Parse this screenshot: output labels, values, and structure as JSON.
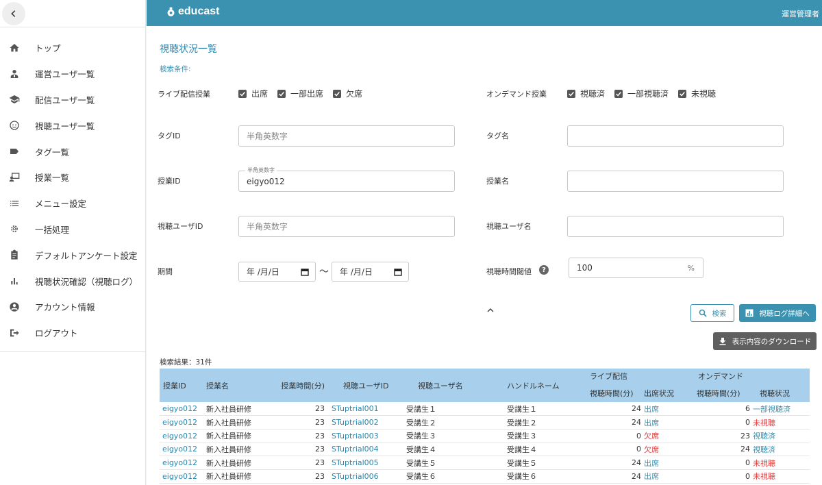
{
  "sidebar": {
    "items": [
      {
        "label": "トップ",
        "icon": "home-icon"
      },
      {
        "label": "運営ユーザ一覧",
        "icon": "admin-user-icon"
      },
      {
        "label": "配信ユーザ一覧",
        "icon": "graduation-cap-icon"
      },
      {
        "label": "視聴ユーザ一覧",
        "icon": "face-icon"
      },
      {
        "label": "タグ一覧",
        "icon": "tag-icon"
      },
      {
        "label": "授業一覧",
        "icon": "lecture-icon"
      },
      {
        "label": "メニュー設定",
        "icon": "list-icon"
      },
      {
        "label": "一括処理",
        "icon": "gear-icon"
      },
      {
        "label": "デフォルトアンケート設定",
        "icon": "clipboard-icon"
      },
      {
        "label": "視聴状況確認（視聴ログ）",
        "icon": "bar-chart-icon"
      },
      {
        "label": "アカウント情報",
        "icon": "account-icon"
      },
      {
        "label": "ログアウト",
        "icon": "logout-icon"
      }
    ]
  },
  "header": {
    "brand": "educast",
    "user": "運営管理者"
  },
  "page": {
    "title": "視聴状況一覧",
    "conditions_label": "検索条件:"
  },
  "filters": {
    "live_label": "ライブ配信授業",
    "live_options": [
      "出席",
      "一部出席",
      "欠席"
    ],
    "ondemand_label": "オンデマンド授業",
    "ondemand_options": [
      "視聴済",
      "一部視聴済",
      "未視聴"
    ],
    "tag_id_label": "タグID",
    "tag_id_placeholder": "半角英数字",
    "tag_name_label": "タグ名",
    "lecture_id_label": "授業ID",
    "lecture_id_floating": "半角英数字",
    "lecture_id_value": "eigyo012",
    "lecture_name_label": "授業名",
    "viewer_id_label": "視聴ユーザID",
    "viewer_id_placeholder": "半角英数字",
    "viewer_name_label": "視聴ユーザ名",
    "period_label": "期間",
    "date_placeholder": "年 /月/日",
    "tilde": "～",
    "threshold_label": "視聴時間閾値",
    "threshold_value": "100",
    "threshold_unit": "%"
  },
  "buttons": {
    "search": "検索",
    "log_detail": "視聴ログ詳細へ",
    "download": "表示内容のダウンロード"
  },
  "results": {
    "summary": "検索結果：31件"
  },
  "table": {
    "headers": {
      "lecture_id": "授業ID",
      "lecture_name": "授業名",
      "lecture_time": "授業時間(分)",
      "viewer_id": "視聴ユーザID",
      "viewer_name": "視聴ユーザ名",
      "handle": "ハンドルネーム",
      "live": "ライブ配信",
      "ondemand": "オンデマンド",
      "live_time": "視聴時間(分)",
      "live_status": "出席状況",
      "od_time": "視聴時間(分)",
      "od_status": "視聴状況"
    },
    "rows": [
      {
        "id": "eigyo012",
        "name": "新入社員研修",
        "time": "23",
        "vid": "STuptrial001",
        "vname": "受講生１",
        "handle": "受講生１",
        "ltime": "24",
        "lstatus": "出席",
        "otime": "6",
        "ostatus": "一部視聴済"
      },
      {
        "id": "eigyo012",
        "name": "新入社員研修",
        "time": "23",
        "vid": "STuptrial002",
        "vname": "受講生２",
        "handle": "受講生２",
        "ltime": "24",
        "lstatus": "出席",
        "otime": "0",
        "ostatus": "未視聴"
      },
      {
        "id": "eigyo012",
        "name": "新入社員研修",
        "time": "23",
        "vid": "STuptrial003",
        "vname": "受講生３",
        "handle": "受講生３",
        "ltime": "0",
        "lstatus": "欠席",
        "otime": "23",
        "ostatus": "視聴済"
      },
      {
        "id": "eigyo012",
        "name": "新入社員研修",
        "time": "23",
        "vid": "STuptrial004",
        "vname": "受講生４",
        "handle": "受講生４",
        "ltime": "0",
        "lstatus": "欠席",
        "otime": "24",
        "ostatus": "視聴済"
      },
      {
        "id": "eigyo012",
        "name": "新入社員研修",
        "time": "23",
        "vid": "STuptrial005",
        "vname": "受講生５",
        "handle": "受講生５",
        "ltime": "24",
        "lstatus": "出席",
        "otime": "0",
        "ostatus": "未視聴"
      },
      {
        "id": "eigyo012",
        "name": "新入社員研修",
        "time": "23",
        "vid": "STuptrial006",
        "vname": "受講生６",
        "handle": "受講生６",
        "ltime": "24",
        "lstatus": "出席",
        "otime": "0",
        "ostatus": "未視聴"
      }
    ]
  },
  "colors": {
    "primary": "#3a91b0",
    "table_header": "#a8d0ed",
    "alert": "#e23b3b"
  }
}
